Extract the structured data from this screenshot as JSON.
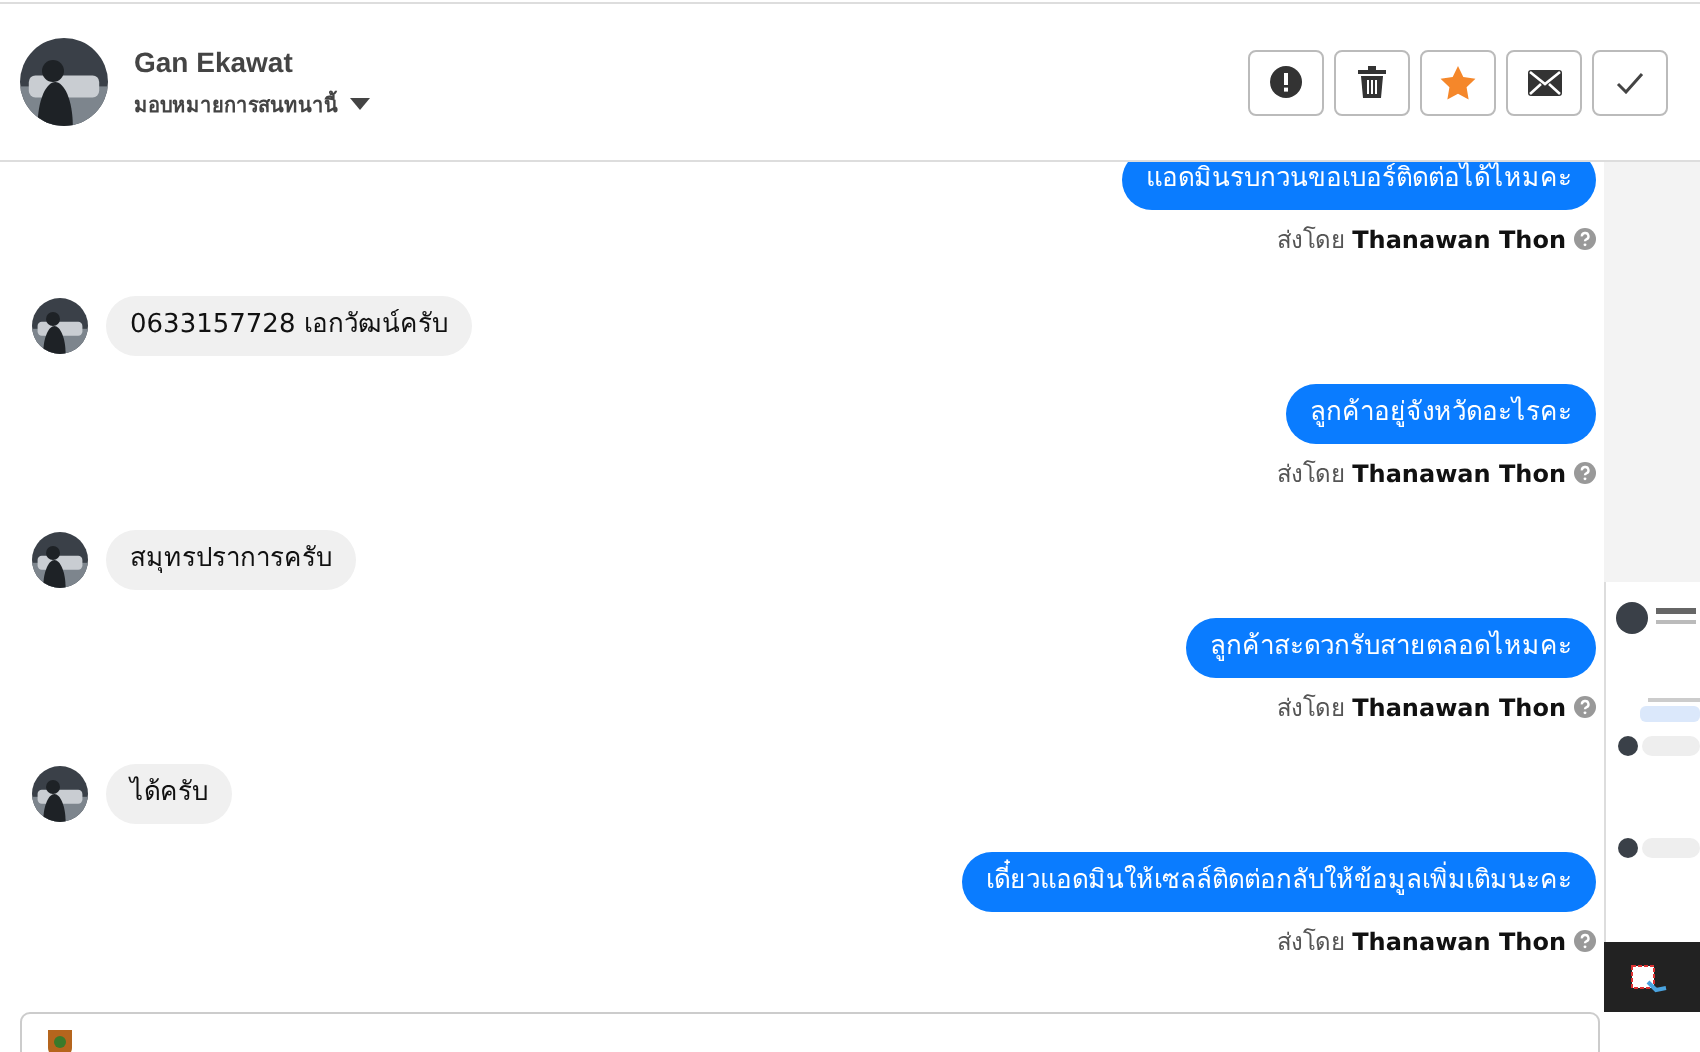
{
  "contact": {
    "name": "Gan Ekawat",
    "assign": "มอบหมายการสนทนานี้"
  },
  "actions": [
    {
      "kind": "alert"
    },
    {
      "kind": "trash"
    },
    {
      "kind": "star"
    },
    {
      "kind": "mail"
    },
    {
      "kind": "done"
    }
  ],
  "messages": [
    {
      "kind": "out",
      "text": "แอดมินรบกวนขอเบอร์ติดต่อได้ไหมคะ",
      "sent_by_label": "ส่งโดย",
      "sender": "Thanawan Thon"
    },
    {
      "kind": "in",
      "text": "0633157728 เอกวัฒน์ครับ"
    },
    {
      "kind": "out",
      "text": "ลูกค้าอยู่จังหวัดอะไรคะ",
      "sent_by_label": "ส่งโดย",
      "sender": "Thanawan Thon"
    },
    {
      "kind": "in",
      "text": "สมุทรปราการครับ"
    },
    {
      "kind": "out",
      "text": "ลูกค้าสะดวกรับสายตลอดไหมคะ",
      "sent_by_label": "ส่งโดย",
      "sender": "Thanawan Thon"
    },
    {
      "kind": "in",
      "text": "ได้ครับ"
    },
    {
      "kind": "out",
      "text": "เดี๋ยวแอดมินให้เซลล์ติดต่อกลับให้ข้อมูลเพิ่มเติมนะคะ",
      "sent_by_label": "ส่งโดย",
      "sender": "Thanawan Thon"
    }
  ]
}
